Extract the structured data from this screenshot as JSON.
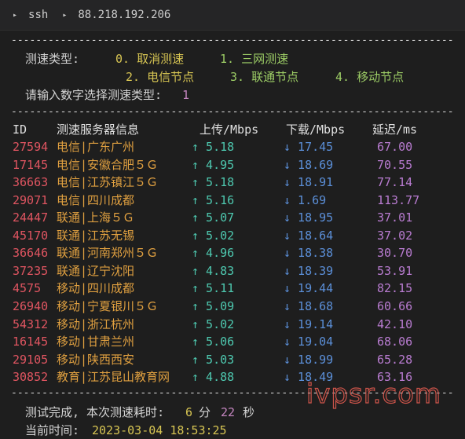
{
  "titlebar": {
    "cmd": "ssh",
    "host": "88.218.192.206"
  },
  "separator": "-----------------------------------------------------------------------------------",
  "menu": {
    "label": "测速类型:",
    "opt0": "0. 取消测速",
    "opt1": "1. 三网测速",
    "opt2": "2. 电信节点",
    "opt3": "3. 联通节点",
    "opt4": "4. 移动节点",
    "prompt": "请输入数字选择测速类型:",
    "choice": "1"
  },
  "table": {
    "headers": [
      "ID",
      "测速服务器信息",
      "上传/Mbps",
      "下载/Mbps",
      "延迟/ms"
    ],
    "rows": [
      {
        "id": "27594",
        "server": "电信|广东广州",
        "up": "↑ 5.18",
        "down": "↓ 17.45",
        "latency": "67.00"
      },
      {
        "id": "17145",
        "server": "电信|安徽合肥５Ｇ",
        "up": "↑ 4.95",
        "down": "↓ 18.69",
        "latency": "70.55"
      },
      {
        "id": "36663",
        "server": "电信|江苏镇江５Ｇ",
        "up": "↑ 5.18",
        "down": "↓ 18.91",
        "latency": "77.14"
      },
      {
        "id": "29071",
        "server": "电信|四川成都",
        "up": "↑ 5.16",
        "down": "↓ 1.69",
        "latency": "113.77"
      },
      {
        "id": "24447",
        "server": "联通|上海５Ｇ",
        "up": "↑ 5.07",
        "down": "↓ 18.95",
        "latency": "37.01"
      },
      {
        "id": "45170",
        "server": "联通|江苏无锡",
        "up": "↑ 5.02",
        "down": "↓ 18.64",
        "latency": "37.02"
      },
      {
        "id": "36646",
        "server": "联通|河南郑州５Ｇ",
        "up": "↑ 4.96",
        "down": "↓ 18.38",
        "latency": "30.70"
      },
      {
        "id": "37235",
        "server": "联通|辽宁沈阳",
        "up": "↑ 4.83",
        "down": "↓ 18.39",
        "latency": "53.91"
      },
      {
        "id": "4575",
        "server": "移动|四川成都",
        "up": "↑ 5.11",
        "down": "↓ 19.44",
        "latency": "82.15"
      },
      {
        "id": "26940",
        "server": "移动|宁夏银川５Ｇ",
        "up": "↑ 5.09",
        "down": "↓ 18.68",
        "latency": "60.66"
      },
      {
        "id": "54312",
        "server": "移动|浙江杭州",
        "up": "↑ 5.02",
        "down": "↓ 19.14",
        "latency": "42.10"
      },
      {
        "id": "16145",
        "server": "移动|甘肃兰州",
        "up": "↑ 5.06",
        "down": "↓ 19.04",
        "latency": "68.06"
      },
      {
        "id": "29105",
        "server": "移动|陕西西安",
        "up": "↑ 5.03",
        "down": "↓ 18.99",
        "latency": "65.28"
      },
      {
        "id": "30852",
        "server": "教育|江苏昆山教育网",
        "up": "↑ 4.88",
        "down": "↓ 18.49",
        "latency": "63.16"
      }
    ]
  },
  "footer": {
    "done_label": "测试完成, 本次测速耗时:",
    "minutes": "6",
    "min_unit": "分",
    "seconds": "22",
    "sec_unit": "秒",
    "time_label": "当前时间:",
    "time_value": "2023-03-04 18:53:25"
  },
  "watermark": "ivpsr.com"
}
